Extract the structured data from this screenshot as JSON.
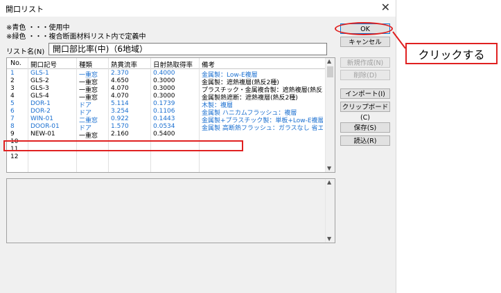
{
  "window": {
    "title": "開口リスト",
    "close_glyph": "✕"
  },
  "notes": [
    "※青色 ・・・使用中",
    "※緑色 ・・・複合断面材料リスト内で定義中"
  ],
  "list_name": {
    "label": "リスト名(N)",
    "value": "開口部比率(中)（6地域）"
  },
  "table": {
    "headers": [
      "No.",
      "開口記号",
      "種類",
      "熱貫流率",
      "日射熱取得率",
      "備考"
    ],
    "rows": [
      {
        "no": "1",
        "code": "GLS-1",
        "type": "一重窓",
        "u": "2.370",
        "eta": "0.4000",
        "note": "金属製：Low-E複層",
        "color": "#1a6fd0"
      },
      {
        "no": "2",
        "code": "GLS-2",
        "type": "一重窓",
        "u": "4.650",
        "eta": "0.3000",
        "note": "金属製：遮熱複層(熱反2種)",
        "color": "#000000"
      },
      {
        "no": "3",
        "code": "GLS-3",
        "type": "一重窓",
        "u": "4.070",
        "eta": "0.3000",
        "note": "プラスチック・金属複合製：遮熱複層(熱反2…",
        "color": "#000000"
      },
      {
        "no": "4",
        "code": "GLS-4",
        "type": "一重窓",
        "u": "4.070",
        "eta": "0.3000",
        "note": "金属製熱遮断：遮熱複層(熱反2種)",
        "color": "#000000"
      },
      {
        "no": "5",
        "code": "DOR-1",
        "type": "ドア",
        "u": "5.114",
        "eta": "0.1739",
        "note": "木製：複層",
        "color": "#1a6fd0"
      },
      {
        "no": "6",
        "code": "DOR-2",
        "type": "ドア",
        "u": "3.254",
        "eta": "0.1106",
        "note": "金属製 ハニカムフラッシュ：複層",
        "color": "#1a6fd0"
      },
      {
        "no": "7",
        "code": "WIN-01",
        "type": "二重窓",
        "u": "0.922",
        "eta": "0.1443",
        "note": "金属製+プラスチック製：単板+Low-E複層 …",
        "color": "#1a6fd0"
      },
      {
        "no": "8",
        "code": "DOOR-01",
        "type": "ドア",
        "u": "1.570",
        "eta": "0.0534",
        "note": "金属製 高断熱フラッシュ：ガラスなし 省エ…",
        "color": "#1a6fd0"
      },
      {
        "no": "9",
        "code": "NEW-01",
        "type": "一重窓",
        "u": "2.160",
        "eta": "0.5400",
        "note": "",
        "color": "#000000"
      },
      {
        "no": "10",
        "code": "",
        "type": "",
        "u": "",
        "eta": "",
        "note": "",
        "color": "#000000"
      },
      {
        "no": "11",
        "code": "",
        "type": "",
        "u": "",
        "eta": "",
        "note": "",
        "color": "#000000"
      },
      {
        "no": "12",
        "code": "",
        "type": "",
        "u": "",
        "eta": "",
        "note": "",
        "color": "#000000"
      }
    ]
  },
  "buttons": {
    "ok": "OK",
    "cancel": "キャンセル",
    "new_create": "新規作成(N)",
    "delete": "削除(D)",
    "import": "インポート(I)",
    "clipboard": "クリップボード(C)",
    "save": "保存(S)",
    "load": "読込(R)"
  },
  "callout": {
    "text": "クリックする"
  },
  "colors": {
    "in_use": "#1a6fd0",
    "highlight": "#e02020"
  }
}
